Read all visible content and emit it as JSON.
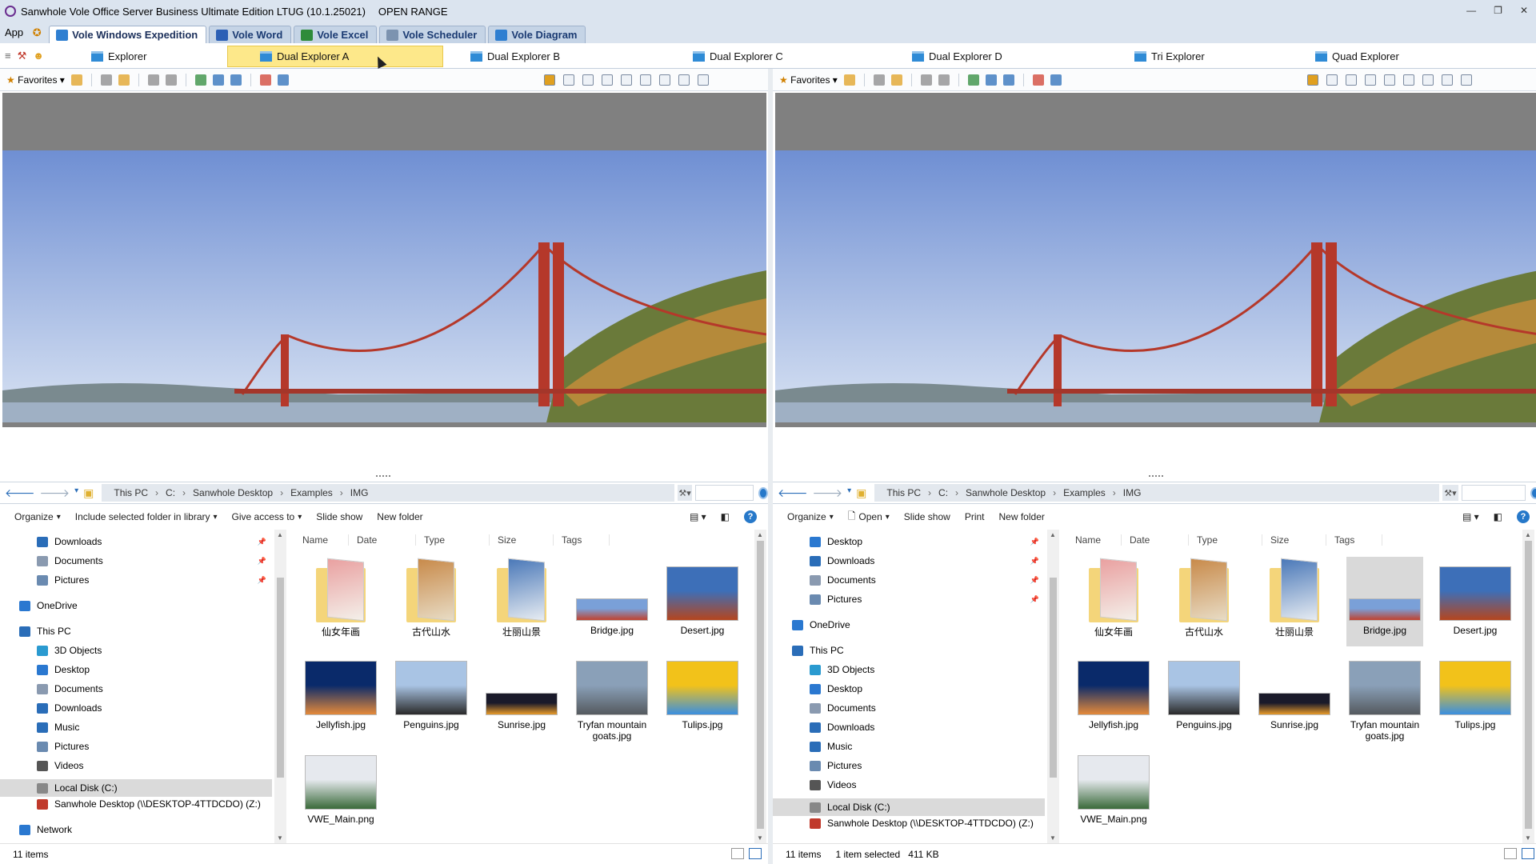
{
  "window": {
    "title": "Sanwhole Vole Office Server Business Ultimate Edition LTUG (10.1.25021)",
    "extra": "OPEN RANGE"
  },
  "appbar": {
    "menu": "App",
    "tabs": [
      {
        "label": "Vole Windows Expedition",
        "color": "#2f7fd1"
      },
      {
        "label": "Vole Word",
        "color": "#2b5fb5"
      },
      {
        "label": "Vole Excel",
        "color": "#2e8b3a"
      },
      {
        "label": "Vole Scheduler",
        "color": "#7c93b0"
      },
      {
        "label": "Vole Diagram",
        "color": "#2f7fd1"
      }
    ]
  },
  "explorer_tabs": [
    "Explorer",
    "Dual Explorer A",
    "Dual Explorer B",
    "Dual Explorer C",
    "Dual Explorer D",
    "Tri Explorer",
    "Quad Explorer"
  ],
  "toolbar": {
    "favorites": "Favorites"
  },
  "breadcrumb": [
    "This PC",
    "C:",
    "Sanwhole Desktop",
    "Examples",
    "IMG"
  ],
  "left": {
    "commands": [
      "Organize",
      "Include selected folder in library",
      "Give access to",
      "Slide show",
      "New folder"
    ],
    "nav": [
      {
        "label": "Downloads",
        "icon": "download-icon",
        "pinned": true
      },
      {
        "label": "Documents",
        "icon": "documents-icon",
        "pinned": true
      },
      {
        "label": "Pictures",
        "icon": "pictures-icon",
        "pinned": true
      },
      {
        "label": "OneDrive",
        "icon": "cloud-icon"
      },
      {
        "label": "This PC",
        "icon": "computer-icon"
      },
      {
        "label": "3D Objects",
        "icon": "cube-icon"
      },
      {
        "label": "Desktop",
        "icon": "desktop-icon"
      },
      {
        "label": "Documents",
        "icon": "documents-icon"
      },
      {
        "label": "Downloads",
        "icon": "download-icon"
      },
      {
        "label": "Music",
        "icon": "music-icon"
      },
      {
        "label": "Pictures",
        "icon": "pictures-icon"
      },
      {
        "label": "Videos",
        "icon": "videos-icon"
      },
      {
        "label": "Local Disk (C:)",
        "icon": "drive-icon",
        "selected": true
      },
      {
        "label": "Sanwhole Desktop (\\\\DESKTOP-4TTDCDO) (Z:)",
        "icon": "network-drive-icon"
      },
      {
        "label": "Network",
        "icon": "network-icon"
      }
    ],
    "status": {
      "count": "11 items"
    }
  },
  "right": {
    "commands": [
      "Organize",
      "Open",
      "Slide show",
      "Print",
      "New folder"
    ],
    "nav": [
      {
        "label": "Desktop",
        "icon": "desktop-icon",
        "pinned": true
      },
      {
        "label": "Downloads",
        "icon": "download-icon",
        "pinned": true
      },
      {
        "label": "Documents",
        "icon": "documents-icon",
        "pinned": true
      },
      {
        "label": "Pictures",
        "icon": "pictures-icon",
        "pinned": true
      },
      {
        "label": "OneDrive",
        "icon": "cloud-icon"
      },
      {
        "label": "This PC",
        "icon": "computer-icon"
      },
      {
        "label": "3D Objects",
        "icon": "cube-icon"
      },
      {
        "label": "Desktop",
        "icon": "desktop-icon"
      },
      {
        "label": "Documents",
        "icon": "documents-icon"
      },
      {
        "label": "Downloads",
        "icon": "download-icon"
      },
      {
        "label": "Music",
        "icon": "music-icon"
      },
      {
        "label": "Pictures",
        "icon": "pictures-icon"
      },
      {
        "label": "Videos",
        "icon": "videos-icon"
      },
      {
        "label": "Local Disk (C:)",
        "icon": "drive-icon",
        "selected": true
      },
      {
        "label": "Sanwhole Desktop (\\\\DESKTOP-4TTDCDO) (Z:)",
        "icon": "network-drive-icon"
      }
    ],
    "status": {
      "count": "11 items",
      "selection": "1 item selected",
      "size": "411 KB"
    },
    "selected_file": "Bridge.jpg"
  },
  "columns": [
    "Name",
    "Date",
    "Type",
    "Size",
    "Tags"
  ],
  "files": [
    {
      "name": "仙女年画",
      "kind": "folder",
      "colors": [
        "#e9a0a0",
        "#f4f0ea"
      ]
    },
    {
      "name": "古代山水",
      "kind": "folder",
      "colors": [
        "#c88a4a",
        "#e8dcc5"
      ]
    },
    {
      "name": "壮丽山景",
      "kind": "folder",
      "colors": [
        "#4a78b8",
        "#e7ecf2"
      ]
    },
    {
      "name": "Bridge.jpg",
      "kind": "image",
      "colors": [
        "#7aa0d8",
        "#c0422f"
      ]
    },
    {
      "name": "Desert.jpg",
      "kind": "image",
      "colors": [
        "#3d6fb8",
        "#b5451e"
      ]
    },
    {
      "name": "Jellyfish.jpg",
      "kind": "image",
      "colors": [
        "#0a2a6a",
        "#e58a3a"
      ]
    },
    {
      "name": "Penguins.jpg",
      "kind": "image",
      "colors": [
        "#a9c4e4",
        "#2a2a2a"
      ]
    },
    {
      "name": "Sunrise.jpg",
      "kind": "image",
      "colors": [
        "#1a1a2a",
        "#e89a2a"
      ]
    },
    {
      "name": "Tryfan mountain goats.jpg",
      "kind": "image",
      "colors": [
        "#8aa0b8",
        "#555a5f"
      ]
    },
    {
      "name": "Tulips.jpg",
      "kind": "image",
      "colors": [
        "#f2c21a",
        "#3a8fe0"
      ]
    },
    {
      "name": "VWE_Main.png",
      "kind": "image",
      "colors": [
        "#e6e9ee",
        "#3a6a3a"
      ]
    }
  ]
}
